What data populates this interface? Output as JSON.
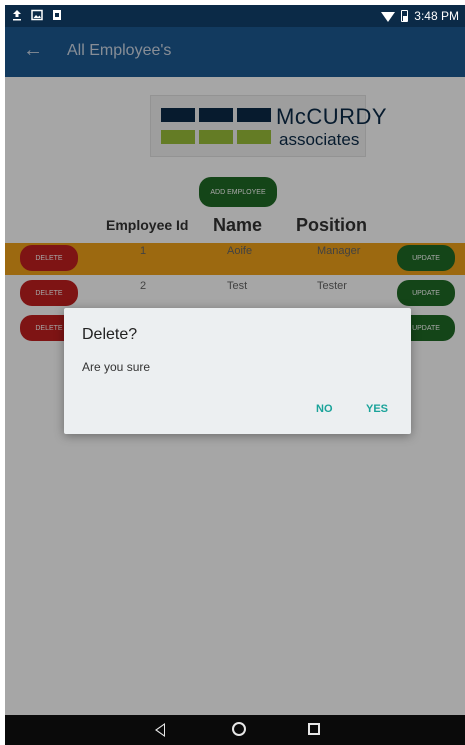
{
  "status_bar": {
    "time": "3:48 PM"
  },
  "app_bar": {
    "back_icon": "arrow-left-icon",
    "title": "All Employee's"
  },
  "logo": {
    "line1": "McCURDY",
    "line2": "associates",
    "colors": [
      "#0b2a47",
      "#9abf3a"
    ]
  },
  "actions": {
    "add_employee": "ADD EMPLOYEE"
  },
  "table": {
    "columns": [
      "Employee Id",
      "Name",
      "Position"
    ],
    "rows": [
      {
        "id": "1",
        "name": "Aoife",
        "position": "Manager",
        "delete": "DELETE",
        "update": "UPDATE",
        "highlighted": true
      },
      {
        "id": "2",
        "name": "Test",
        "position": "Tester",
        "delete": "DELETE",
        "update": "UPDATE",
        "highlighted": false
      },
      {
        "id": "",
        "name": "",
        "position": "",
        "delete": "DELETE",
        "update": "UPDATE",
        "highlighted": false
      }
    ]
  },
  "dialog": {
    "title": "Delete?",
    "message": "Are you sure",
    "no_label": "NO",
    "yes_label": "YES"
  },
  "colors": {
    "app_bar": "#1c5a93",
    "status_bar": "#0b2a47",
    "highlight_row": "#f0a21a",
    "delete_button": "#c21f1f",
    "update_button": "#1f6b25",
    "dialog_button_text": "#1aa39a"
  }
}
